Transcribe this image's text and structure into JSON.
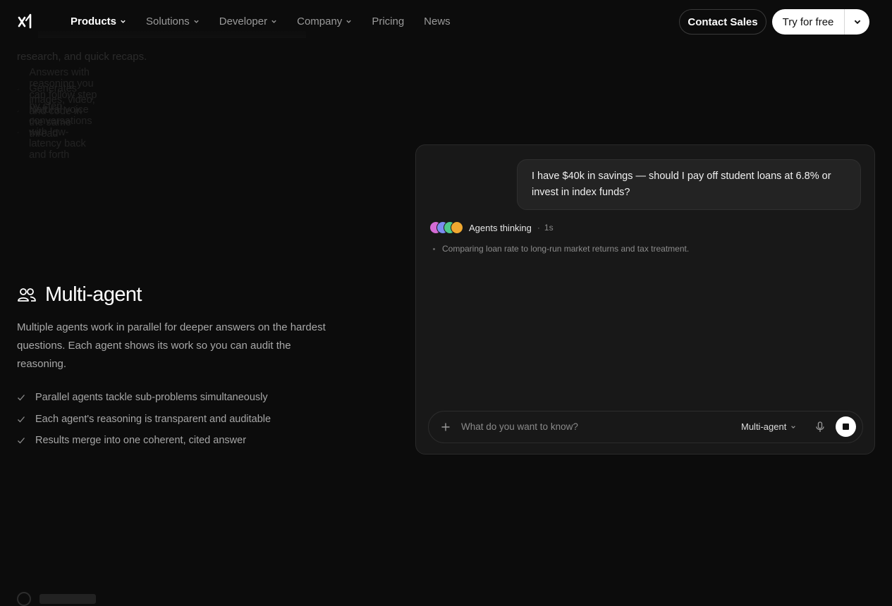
{
  "nav": {
    "links": [
      {
        "label": "Products",
        "dropdown": true,
        "active": true
      },
      {
        "label": "Solutions",
        "dropdown": true
      },
      {
        "label": "Developer",
        "dropdown": true
      },
      {
        "label": "Company",
        "dropdown": true
      },
      {
        "label": "Pricing",
        "dropdown": false
      },
      {
        "label": "News",
        "dropdown": false
      }
    ],
    "contact_label": "Contact Sales",
    "try_label": "Try for free"
  },
  "prev_section": {
    "desc_tail": "research, and quick recaps.",
    "bullets": [
      "Answers with reasoning you can follow step by step",
      "Generates images, video, and code in the same thread",
      "Natural voice conversations with low-latency back and forth"
    ]
  },
  "feature": {
    "title": "Multi-agent",
    "icon": "users-icon",
    "description": "Multiple agents work in parallel for deeper answers on the hardest questions. Each agent shows its work so you can audit the reasoning.",
    "bullets": [
      "Parallel agents tackle sub-problems simultaneously",
      "Each agent's reasoning is transparent and auditable",
      "Results merge into one coherent, cited answer"
    ]
  },
  "chat": {
    "user_message": "I have $40k in savings — should I pay off student loans at 6.8% or invest in index funds?",
    "thinking_label": "Agents thinking",
    "thinking_time": "1s",
    "agent_colors": [
      "#d46bd4",
      "#7b8cf0",
      "#4fc98a",
      "#f0a830"
    ],
    "thought": "Comparing loan rate to long-run market returns and tax treatment.",
    "input_placeholder": "What do you want to know?",
    "mode_label": "Multi-agent"
  }
}
